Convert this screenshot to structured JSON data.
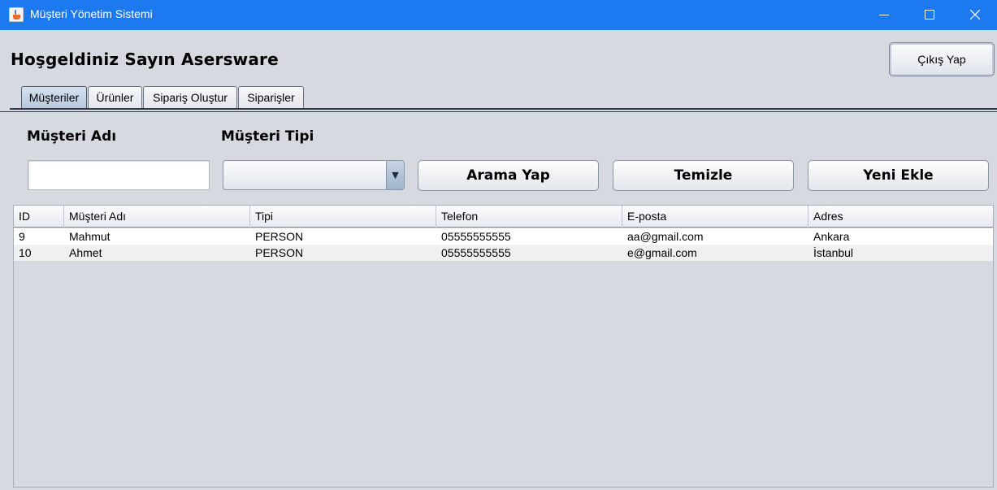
{
  "window": {
    "title": "Müşteri Yönetim Sistemi",
    "icon": "java-cup-icon",
    "controls": [
      "minimize-icon",
      "maximize-icon",
      "close-icon"
    ],
    "accent_color": "#1c79f0"
  },
  "header": {
    "welcome": "Hoşgeldiniz Sayın Asersware",
    "logout_label": "Çıkış Yap"
  },
  "tabs": [
    {
      "label": "Müşteriler",
      "active": true
    },
    {
      "label": "Ürünler",
      "active": false
    },
    {
      "label": "Sipariş Oluştur",
      "active": false
    },
    {
      "label": "Siparişler",
      "active": false
    }
  ],
  "filters": {
    "name_label": "Müşteri Adı",
    "name_value": "",
    "type_label": "Müşteri Tipi",
    "type_selected": ""
  },
  "actions": {
    "search_label": "Arama Yap",
    "clear_label": "Temizle",
    "add_label": "Yeni Ekle"
  },
  "table": {
    "columns": [
      "ID",
      "Müşteri Adı",
      "Tipi",
      "Telefon",
      "E-posta",
      "Adres"
    ],
    "rows": [
      [
        "9",
        "Mahmut",
        "PERSON",
        "05555555555",
        "aa@gmail.com",
        "Ankara"
      ],
      [
        "10",
        "Ahmet",
        "PERSON",
        "05555555555",
        "e@gmail.com",
        "İstanbul"
      ]
    ]
  }
}
